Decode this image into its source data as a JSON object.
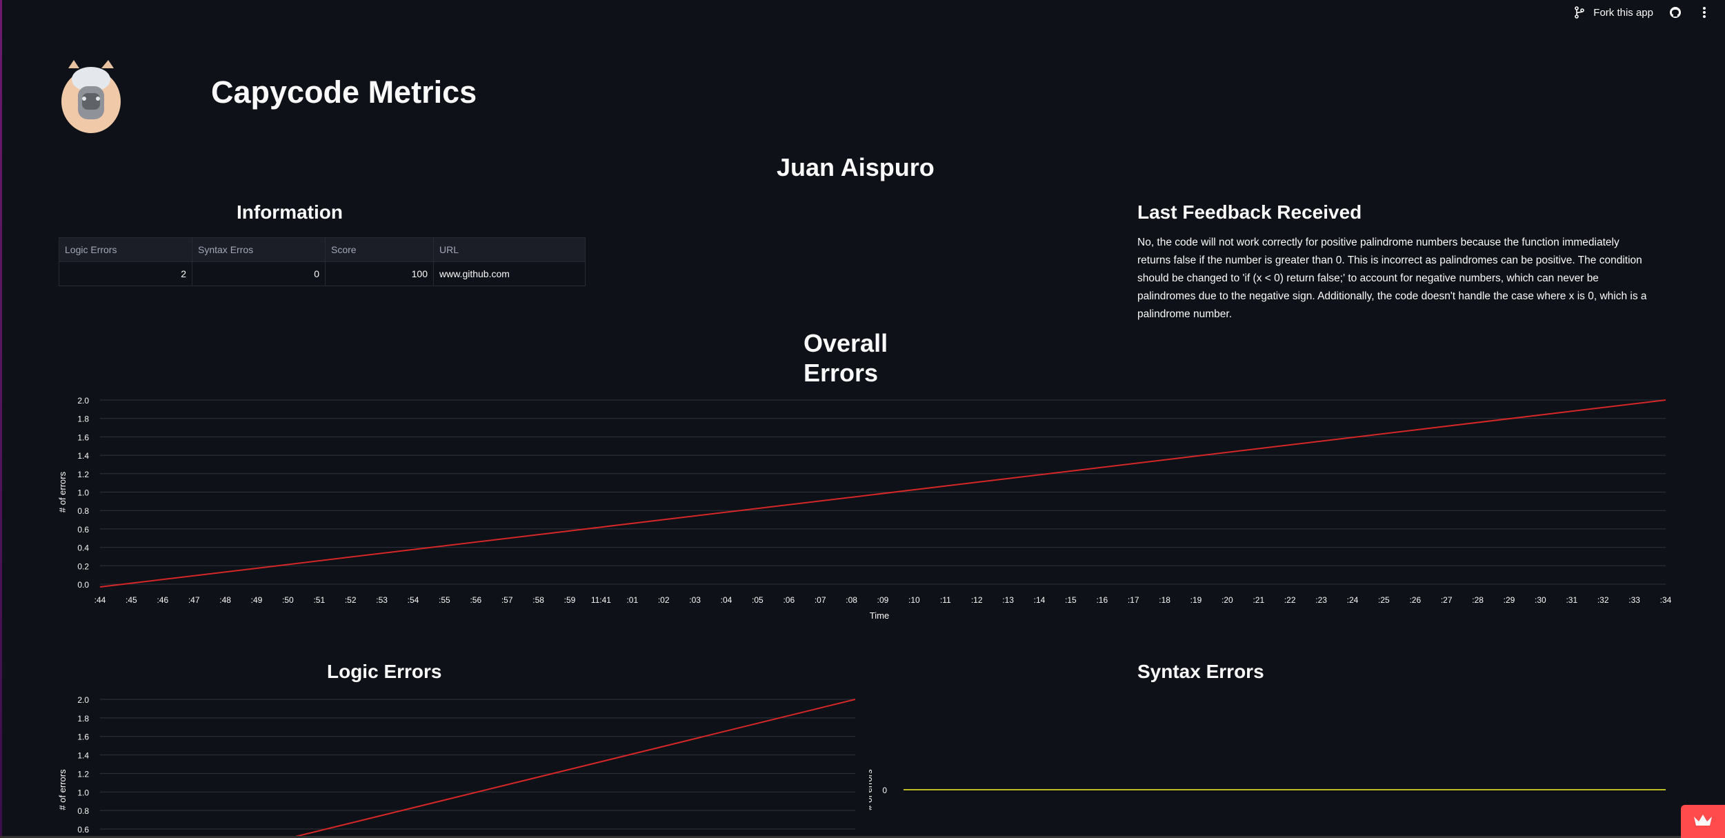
{
  "toolbar": {
    "fork_label": "Fork this app",
    "icons": [
      "fork-icon",
      "github-icon",
      "more-icon"
    ]
  },
  "header": {
    "title": "Capycode Metrics",
    "logo_icon": "capybara-logo"
  },
  "user": {
    "name": "Juan Aispuro"
  },
  "information": {
    "title": "Information",
    "columns": [
      "Logic Errors",
      "Syntax Erros",
      "Score",
      "URL"
    ],
    "row": [
      "2",
      "0",
      "100",
      "www.github.com"
    ]
  },
  "feedback": {
    "title": "Last Feedback Received",
    "text": "No, the code will not work correctly for positive palindrome numbers because the function immediately returns false if the number is greater than 0. This is incorrect as palindromes can be positive. The condition should be changed to 'if (x < 0) return false;' to account for negative numbers, which can never be palindromes due to the negative sign. Additionally, the code doesn't handle the case where x is 0, which is a palindrome number."
  },
  "sections": {
    "logic_title": "Logic Errors",
    "syntax_title": "Syntax Errors"
  },
  "colors": {
    "background": "#0e1117",
    "line_red": "#d62728",
    "line_olive": "#bcbd22",
    "grid": "#31333f",
    "accent": "#ff4b4b"
  },
  "chart_data": [
    {
      "type": "line",
      "title": "Overall\nErrors",
      "xlabel": "Time",
      "ylabel": "# of errors",
      "ylim": [
        0,
        2
      ],
      "yticks": [
        "0.0",
        "0.2",
        "0.4",
        "0.6",
        "0.8",
        "1.0",
        "1.2",
        "1.4",
        "1.6",
        "1.8",
        "2.0"
      ],
      "xticks": [
        ":44",
        ":45",
        ":46",
        ":47",
        ":48",
        ":49",
        ":50",
        ":51",
        ":52",
        ":53",
        ":54",
        ":55",
        ":56",
        ":57",
        ":58",
        ":59",
        "11:41",
        ":01",
        ":02",
        ":03",
        ":04",
        ":05",
        ":06",
        ":07",
        ":08",
        ":09",
        ":10",
        ":11",
        ":12",
        ":13",
        ":14",
        ":15",
        ":16",
        ":17",
        ":18",
        ":19",
        ":20",
        ":21",
        ":22",
        ":23",
        ":24",
        ":25",
        ":26",
        ":27",
        ":28",
        ":29",
        ":30",
        ":31",
        ":32",
        ":33",
        ":34"
      ],
      "series": [
        {
          "x_start": ":44",
          "x_end": ":34",
          "values": [
            0,
            2
          ]
        }
      ],
      "grid": true
    },
    {
      "type": "line",
      "title": "Logic Errors",
      "ylabel": "# of errors",
      "yticks": [
        "0.6",
        "0.8",
        "1.0",
        "1.2",
        "1.4",
        "1.6",
        "1.8",
        "2.0"
      ],
      "ylim": [
        0,
        2
      ],
      "series": [
        {
          "values": [
            0,
            2
          ]
        }
      ],
      "grid": true
    },
    {
      "type": "line",
      "title": "Syntax Errors",
      "ylabel": "# of errors",
      "yticks": [
        "0"
      ],
      "series": [
        {
          "values": [
            0,
            0
          ]
        }
      ],
      "grid": false
    }
  ]
}
